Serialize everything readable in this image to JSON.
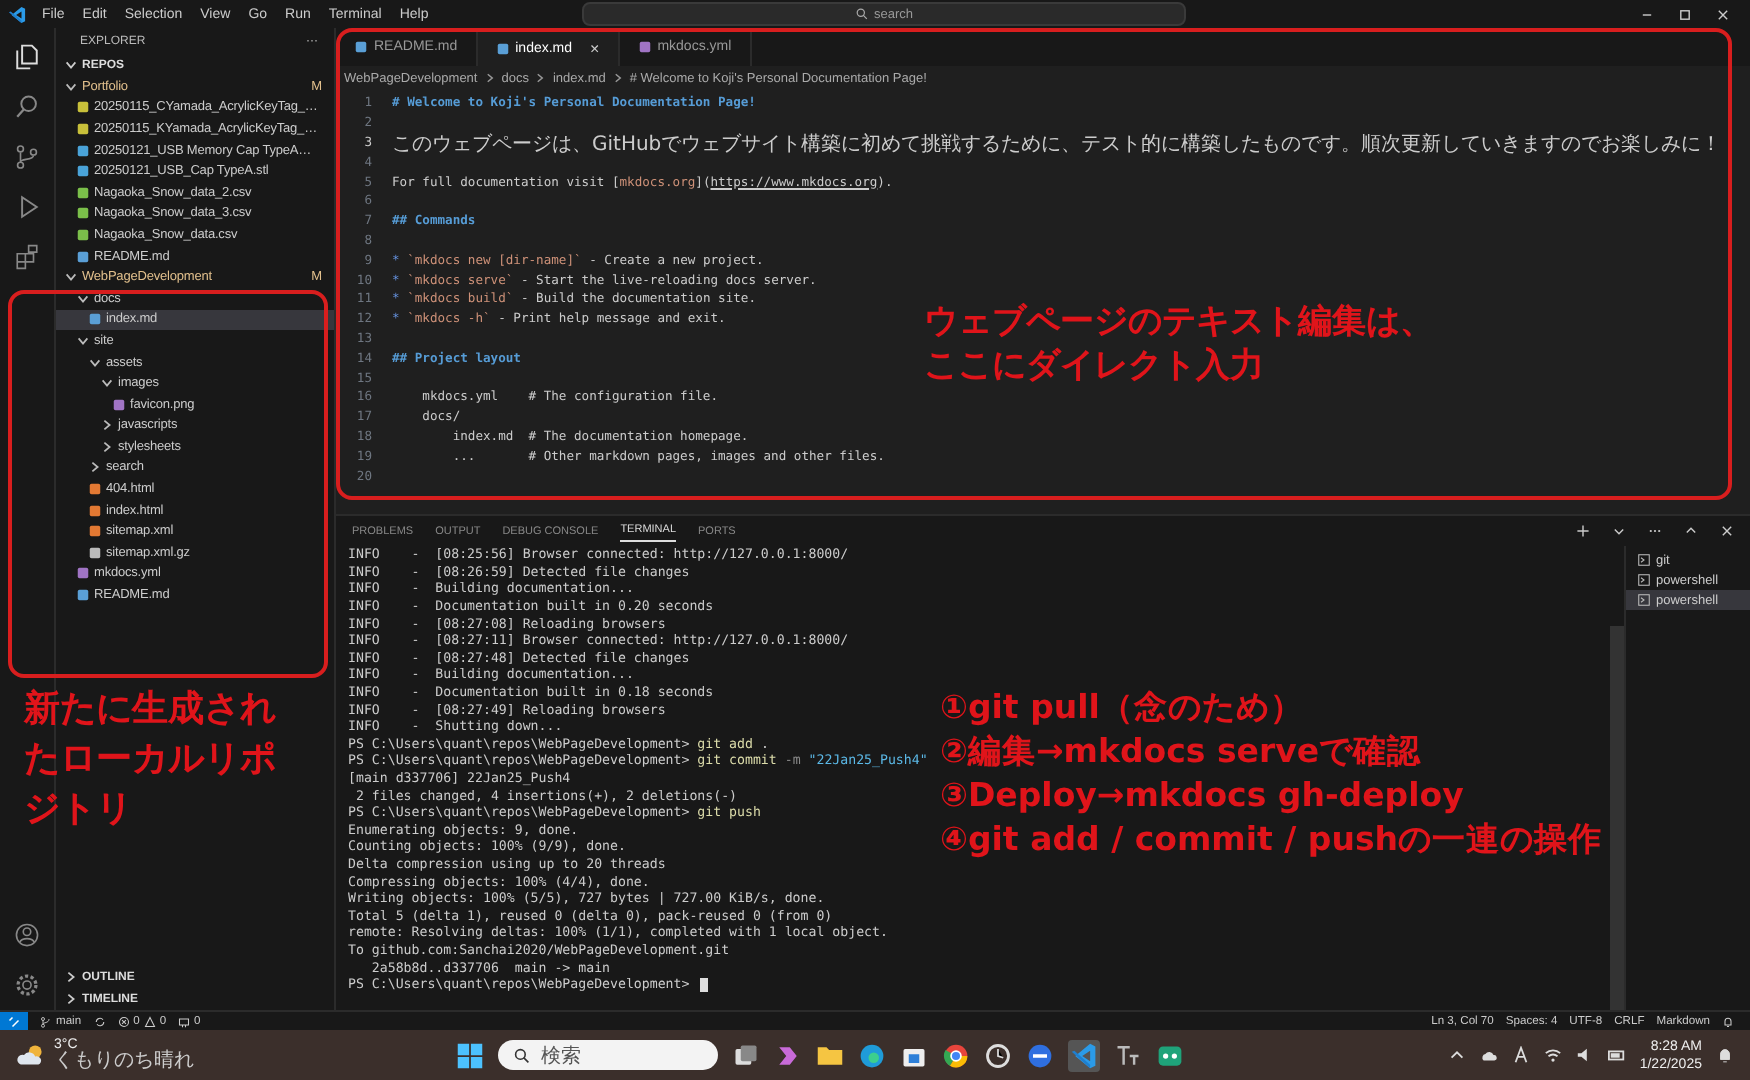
{
  "menu": [
    "File",
    "Edit",
    "Selection",
    "View",
    "Go",
    "Run",
    "Terminal",
    "Help"
  ],
  "command_center": {
    "placeholder": "search"
  },
  "explorer": {
    "title": "EXPLORER",
    "more": "···",
    "section": {
      "label": "REPOS",
      "expanded": true
    },
    "tree": [
      {
        "name": "Portfolio",
        "kind": "folder",
        "expanded": true,
        "badge": "M",
        "selected": false,
        "children": [
          {
            "name": "20250115_CYamada_AcrylicKeyTag_…",
            "kind": "file",
            "color": "#c8c03a",
            "selected": false
          },
          {
            "name": "20250115_KYamada_AcrylicKeyTag_…",
            "kind": "file",
            "color": "#c8c03a",
            "selected": false
          },
          {
            "name": "20250121_USB Memory Cap TypeA…",
            "kind": "file",
            "color": "#4aa3d8",
            "selected": false
          },
          {
            "name": "20250121_USB_Cap TypeA.stl",
            "kind": "file",
            "color": "#4aa3d8",
            "selected": false
          },
          {
            "name": "Nagaoka_Snow_data_2.csv",
            "kind": "file",
            "color": "#7bbf4a",
            "selected": false
          },
          {
            "name": "Nagaoka_Snow_data_3.csv",
            "kind": "file",
            "color": "#7bbf4a",
            "selected": false
          },
          {
            "name": "Nagaoka_Snow_data.csv",
            "kind": "file",
            "color": "#7bbf4a",
            "selected": false
          },
          {
            "name": "README.md",
            "kind": "file",
            "color": "#5a9fd6",
            "selected": false
          }
        ]
      },
      {
        "name": "WebPageDevelopment",
        "kind": "folder",
        "expanded": true,
        "badge": "M",
        "selected": false,
        "children": [
          {
            "name": "docs",
            "kind": "folder",
            "expanded": true,
            "selected": false,
            "children": [
              {
                "name": "index.md",
                "kind": "file",
                "color": "#5a9fd6",
                "selected": true
              }
            ]
          },
          {
            "name": "site",
            "kind": "folder",
            "expanded": true,
            "selected": false,
            "children": [
              {
                "name": "assets",
                "kind": "folder",
                "expanded": true,
                "selected": false,
                "children": [
                  {
                    "name": "images",
                    "kind": "folder",
                    "expanded": true,
                    "selected": false,
                    "children": [
                      {
                        "name": "favicon.png",
                        "kind": "file",
                        "color": "#a074c4",
                        "selected": false
                      }
                    ]
                  },
                  {
                    "name": "javascripts",
                    "kind": "folder",
                    "expanded": false,
                    "selected": false
                  },
                  {
                    "name": "stylesheets",
                    "kind": "folder",
                    "expanded": false,
                    "selected": false
                  }
                ]
              },
              {
                "name": "search",
                "kind": "folder",
                "expanded": false,
                "selected": false
              },
              {
                "name": "404.html",
                "kind": "file",
                "color": "#e37933",
                "selected": false
              },
              {
                "name": "index.html",
                "kind": "file",
                "color": "#e37933",
                "selected": false
              },
              {
                "name": "sitemap.xml",
                "kind": "file",
                "color": "#e37933",
                "selected": false
              },
              {
                "name": "sitemap.xml.gz",
                "kind": "file",
                "color": "#bbbbbb",
                "selected": false
              }
            ]
          },
          {
            "name": "mkdocs.yml",
            "kind": "file",
            "color": "#a074c4",
            "selected": false
          },
          {
            "name": "README.md",
            "kind": "file",
            "color": "#5a9fd6",
            "selected": false
          }
        ]
      }
    ],
    "bottom_sections": [
      {
        "label": "OUTLINE",
        "expanded": false
      },
      {
        "label": "TIMELINE",
        "expanded": false
      }
    ]
  },
  "editor": {
    "tabs": [
      {
        "label": "README.md",
        "selected": false,
        "color": "#5a9fd6"
      },
      {
        "label": "index.md",
        "selected": true,
        "color": "#5a9fd6",
        "close": "×"
      },
      {
        "label": "mkdocs.yml",
        "selected": false,
        "color": "#a074c4"
      }
    ],
    "breadcrumb": [
      "WebPageDevelopment",
      "docs",
      "index.md",
      "# Welcome to Koji's Personal Documentation Page!"
    ],
    "lines": [
      {
        "n": "1",
        "current": false,
        "parts": [
          {
            "kind": "heading",
            "text": "# Welcome to Koji's Personal Documentation Page!"
          }
        ]
      },
      {
        "n": "2",
        "current": false
      },
      {
        "n": "3",
        "current": true,
        "parts": [
          {
            "kind": "jp",
            "text": "このウェブページは、GitHubでウェブサイト構築に初めて挑戦するために、テスト的に構築したものです。順次更新していきますのでお楽しみに！"
          }
        ]
      },
      {
        "n": "4",
        "current": false
      },
      {
        "n": "5",
        "current": false,
        "parts": [
          {
            "kind": "text",
            "text": "For full documentation visit ["
          },
          {
            "kind": "linktext",
            "text": "mkdocs.org"
          },
          {
            "kind": "text",
            "text": "]("
          },
          {
            "kind": "url",
            "text": "https://www.mkdocs.org"
          },
          {
            "kind": "text",
            "text": ")."
          }
        ]
      },
      {
        "n": "6",
        "current": false
      },
      {
        "n": "7",
        "current": false,
        "parts": [
          {
            "kind": "heading",
            "text": "## Commands"
          }
        ]
      },
      {
        "n": "8",
        "current": false
      },
      {
        "n": "9",
        "current": false,
        "parts": [
          {
            "kind": "bullet",
            "text": "* "
          },
          {
            "kind": "code",
            "text": "`mkdocs new [dir-name]`"
          },
          {
            "kind": "text",
            "text": " - Create a new project."
          }
        ]
      },
      {
        "n": "10",
        "current": false,
        "parts": [
          {
            "kind": "bullet",
            "text": "* "
          },
          {
            "kind": "code",
            "text": "`mkdocs serve`"
          },
          {
            "kind": "text",
            "text": " - Start the live-reloading docs server."
          }
        ]
      },
      {
        "n": "11",
        "current": false,
        "parts": [
          {
            "kind": "bullet",
            "text": "* "
          },
          {
            "kind": "code",
            "text": "`mkdocs build`"
          },
          {
            "kind": "text",
            "text": " - Build the documentation site."
          }
        ]
      },
      {
        "n": "12",
        "current": false,
        "parts": [
          {
            "kind": "bullet",
            "text": "* "
          },
          {
            "kind": "code",
            "text": "`mkdocs -h`"
          },
          {
            "kind": "text",
            "text": " - Print help message and exit."
          }
        ]
      },
      {
        "n": "13",
        "current": false
      },
      {
        "n": "14",
        "current": false,
        "parts": [
          {
            "kind": "heading",
            "text": "## Project layout"
          }
        ]
      },
      {
        "n": "15",
        "current": false
      },
      {
        "n": "16",
        "current": false,
        "parts": [
          {
            "kind": "text",
            "text": "    mkdocs.yml    # The configuration file."
          }
        ]
      },
      {
        "n": "17",
        "current": false,
        "parts": [
          {
            "kind": "text",
            "text": "    docs/"
          }
        ]
      },
      {
        "n": "18",
        "current": false,
        "parts": [
          {
            "kind": "text",
            "text": "        index.md  # The documentation homepage."
          }
        ]
      },
      {
        "n": "19",
        "current": false,
        "parts": [
          {
            "kind": "text",
            "text": "        ...       # Other markdown pages, images and other files."
          }
        ]
      },
      {
        "n": "20",
        "current": false
      }
    ]
  },
  "panel": {
    "tabs": [
      {
        "label": "PROBLEMS",
        "selected": false
      },
      {
        "label": "OUTPUT",
        "selected": false
      },
      {
        "label": "DEBUG CONSOLE",
        "selected": false
      },
      {
        "label": "TERMINAL",
        "selected": true
      },
      {
        "label": "PORTS",
        "selected": false
      }
    ],
    "terminal_lines": [
      [
        {
          "kind": "text",
          "text": "INFO    -  [08:25:56] Browser connected: http://127.0.0.1:8000/"
        }
      ],
      [
        {
          "kind": "text",
          "text": "INFO    -  [08:26:59] Detected file changes"
        }
      ],
      [
        {
          "kind": "text",
          "text": "INFO    -  Building documentation..."
        }
      ],
      [
        {
          "kind": "text",
          "text": "INFO    -  Documentation built in 0.20 seconds"
        }
      ],
      [
        {
          "kind": "text",
          "text": "INFO    -  [08:27:08] Reloading browsers"
        }
      ],
      [
        {
          "kind": "text",
          "text": "INFO    -  [08:27:11] Browser connected: http://127.0.0.1:8000/"
        }
      ],
      [
        {
          "kind": "text",
          "text": "INFO    -  [08:27:48] Detected file changes"
        }
      ],
      [
        {
          "kind": "text",
          "text": "INFO    -  Building documentation..."
        }
      ],
      [
        {
          "kind": "text",
          "text": "INFO    -  Documentation built in 0.18 seconds"
        }
      ],
      [
        {
          "kind": "text",
          "text": "INFO    -  [08:27:49] Reloading browsers"
        }
      ],
      [
        {
          "kind": "text",
          "text": "INFO    -  Shutting down..."
        }
      ],
      [
        {
          "kind": "text",
          "text": "PS C:\\Users\\quant\\repos\\WebPageDevelopment> "
        },
        {
          "kind": "cmd",
          "text": "git add"
        },
        {
          "kind": "text",
          "text": " ."
        }
      ],
      [
        {
          "kind": "text",
          "text": "PS C:\\Users\\quant\\repos\\WebPageDevelopment> "
        },
        {
          "kind": "cmd",
          "text": "git commit"
        },
        {
          "kind": "flag",
          "text": " -m "
        },
        {
          "kind": "str",
          "text": "\"22Jan25_Push4\""
        }
      ],
      [
        {
          "kind": "text",
          "text": "[main d337706] 22Jan25_Push4"
        }
      ],
      [
        {
          "kind": "text",
          "text": " 2 files changed, 4 insertions(+), 2 deletions(-)"
        }
      ],
      [
        {
          "kind": "text",
          "text": "PS C:\\Users\\quant\\repos\\WebPageDevelopment> "
        },
        {
          "kind": "cmd",
          "text": "git push"
        }
      ],
      [
        {
          "kind": "text",
          "text": "Enumerating objects: 9, done."
        }
      ],
      [
        {
          "kind": "text",
          "text": "Counting objects: 100% (9/9), done."
        }
      ],
      [
        {
          "kind": "text",
          "text": "Delta compression using up to 20 threads"
        }
      ],
      [
        {
          "kind": "text",
          "text": "Compressing objects: 100% (4/4), done."
        }
      ],
      [
        {
          "kind": "text",
          "text": "Writing objects: 100% (5/5), 727 bytes | 727.00 KiB/s, done."
        }
      ],
      [
        {
          "kind": "text",
          "text": "Total 5 (delta 1), reused 0 (delta 0), pack-reused 0 (from 0)"
        }
      ],
      [
        {
          "kind": "text",
          "text": "remote: Resolving deltas: 100% (1/1), completed with 1 local object."
        }
      ],
      [
        {
          "kind": "text",
          "text": "To github.com:Sanchai2020/WebPageDevelopment.git"
        }
      ],
      [
        {
          "kind": "text",
          "text": "   2a58b8d..d337706  main -> main"
        }
      ],
      [
        {
          "kind": "text",
          "text": "PS C:\\Users\\quant\\repos\\WebPageDevelopment> "
        }
      ]
    ],
    "terminals": [
      {
        "label": "git",
        "selected": false
      },
      {
        "label": "powershell",
        "selected": false
      },
      {
        "label": "powershell",
        "selected": true
      }
    ]
  },
  "status_bar": {
    "branch": "main",
    "errors": "0",
    "warnings": "0",
    "ports": "0",
    "right": [
      "Ln 3, Col 70",
      "Spaces: 4",
      "UTF-8",
      "CRLF",
      "Markdown"
    ]
  },
  "taskbar": {
    "temperature": "3°C",
    "weather": "くもりのち晴れ",
    "search_placeholder": "検索",
    "time": "8:28 AM",
    "date": "1/22/2025"
  },
  "annotations": {
    "editor_note": [
      "ウェブページのテキスト編集は、",
      "ここにダイレクト入力"
    ],
    "explorer_note": "新たに生成されたローカルリポジトリ",
    "steps": [
      "①git pull（念のため）",
      "②編集→mkdocs serveで確認",
      "③Deploy→mkdocs gh-deploy",
      "④git add / commit / pushの一連の操作"
    ]
  }
}
